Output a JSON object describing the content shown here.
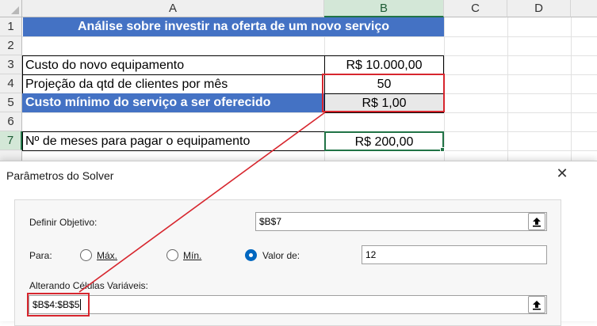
{
  "spreadsheet": {
    "columns": [
      "A",
      "B",
      "C",
      "D"
    ],
    "rows": [
      "1",
      "2",
      "3",
      "4",
      "5",
      "6",
      "7"
    ],
    "banner": "Análise sobre investir na oferta de um novo serviço",
    "r3": {
      "label": "Custo do novo equipamento",
      "value": "R$ 10.000,00"
    },
    "r4": {
      "label": "Projeção da qtd de clientes por mês",
      "value": "50"
    },
    "r5": {
      "label": "Custo mínimo do serviço a ser oferecido",
      "value": "R$ 1,00"
    },
    "r7": {
      "label": "Nº de meses para pagar o equipamento",
      "value": "R$ 200,00"
    }
  },
  "dialog": {
    "title": "Parâmetros do Solver",
    "objective_label": "Definir Objetivo:",
    "objective_value": "$B$7",
    "para_label": "Para:",
    "max_label": "Máx.",
    "min_label": "Mín.",
    "value_of_label": "Valor de:",
    "value_of_value": "12",
    "selected_option": "Valor de",
    "changing_label": "Alterando Células Variáveis:",
    "changing_value": "$B$4:$B$5"
  },
  "colors": {
    "banner": "#4472c4",
    "highlight": "#d7262e",
    "excel_green": "#217346",
    "radio_selected": "#0067c0"
  }
}
